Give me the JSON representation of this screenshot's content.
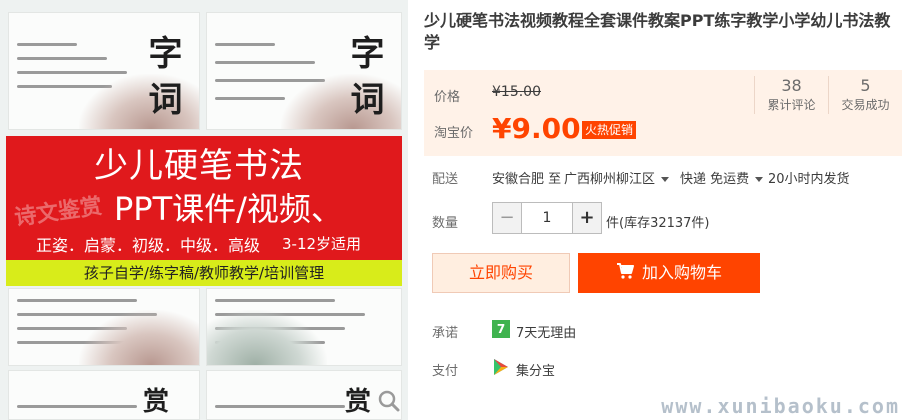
{
  "gallery": {
    "slide_chars_top_left": "字\n词",
    "slide_chars_top_right": "字\n词",
    "slide_chars_bottom_left": "赏",
    "slide_chars_bottom_right": "赏",
    "banner_title_line1": "少儿硬笔书法",
    "banner_title_line2": "PPT课件/视频、",
    "banner_levels": "正姿．启蒙．初级．中级．高级",
    "banner_age": "3-12岁适用",
    "banner_strip": "孩子自学/练字稿/教师教学/培训管理",
    "banner_stamp": "诗文鉴赏"
  },
  "product": {
    "title": "少儿硬笔书法视频教程全套课件教案PPT练字教学小学幼儿书法教学"
  },
  "price": {
    "label": "价格",
    "original": "¥15.00",
    "taobao_label": "淘宝价",
    "current": "¥9.00",
    "promo_tag": "火热促销"
  },
  "stats": [
    {
      "num": "38",
      "caption": "累计评论"
    },
    {
      "num": "5",
      "caption": "交易成功"
    }
  ],
  "shipping": {
    "label": "配送",
    "from": "安徽合肥 至",
    "to": "广西柳州柳江区",
    "method": "快递 免运费",
    "time": "20小时内发货"
  },
  "quantity": {
    "label": "数量",
    "minus": "−",
    "value": "1",
    "plus": "+",
    "stock": "件(库存32137件)"
  },
  "actions": {
    "buy_now": "立即购买",
    "add_to_cart": "加入购物车"
  },
  "promise": {
    "label": "承诺",
    "badge": "7",
    "text": "7天无理由"
  },
  "payment": {
    "label": "支付",
    "text": "集分宝"
  },
  "watermark": "www.xunibaoku.com",
  "colors": {
    "accent": "#ff4400",
    "price_bg": "#fff2e8",
    "banner_red": "#e0191c",
    "banner_strip": "#d8ec1a",
    "promise_green": "#3fb34f"
  },
  "icons": [
    "zoom-icon",
    "cart-icon",
    "seven-day-badge-icon",
    "jifenbao-icon",
    "caret-down-icon"
  ]
}
